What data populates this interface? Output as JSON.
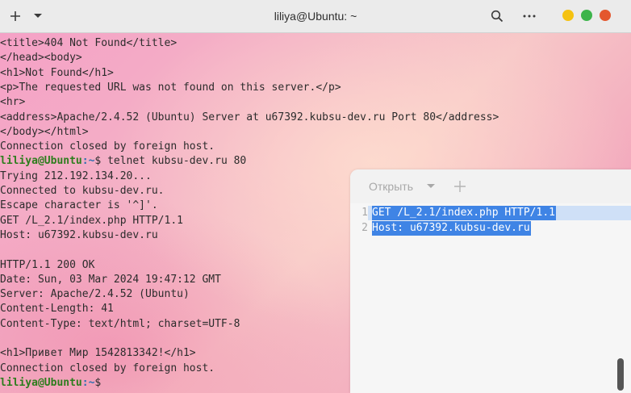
{
  "window": {
    "title": "liliya@Ubuntu: ~"
  },
  "terminal": {
    "lines": [
      "<title>404 Not Found</title>",
      "</head><body>",
      "<h1>Not Found</h1>",
      "<p>The requested URL was not found on this server.</p>",
      "<hr>",
      "<address>Apache/2.4.52 (Ubuntu) Server at u67392.kubsu-dev.ru Port 80</address>",
      "</body></html>",
      "Connection closed by foreign host.",
      "",
      "Trying 212.192.134.20...",
      "Connected to kubsu-dev.ru.",
      "Escape character is '^]'.",
      "GET /L_2.1/index.php HTTP/1.1",
      "Host: u67392.kubsu-dev.ru",
      "",
      "HTTP/1.1 200 OK",
      "Date: Sun, 03 Mar 2024 19:47:12 GMT",
      "Server: Apache/2.4.52 (Ubuntu)",
      "Content-Length: 41",
      "Content-Type: text/html; charset=UTF-8",
      "",
      "<h1>Привет Мир 1542813342!</h1>",
      "Connection closed by foreign host.",
      ""
    ],
    "prompt1": {
      "user": "liliya@Ubuntu",
      "path": ":~",
      "symbol": "$ ",
      "command": "telnet kubsu-dev.ru 80"
    },
    "prompt2": {
      "user": "liliya@Ubuntu",
      "path": ":~",
      "symbol": "$",
      "command": ""
    }
  },
  "editor": {
    "open_label": "Открыть",
    "lines": [
      {
        "number": "1",
        "text": "GET /L_2.1/index.php HTTP/1.1"
      },
      {
        "number": "2",
        "text": "Host: u67392.kubsu-dev.ru"
      }
    ]
  },
  "colors": {
    "selection": "#3f84e5",
    "prompt_user": "#2d7d1d",
    "prompt_path": "#2f6fb0",
    "close": "#e4572e",
    "maximize": "#3cb44b",
    "minimize": "#f5c211"
  }
}
